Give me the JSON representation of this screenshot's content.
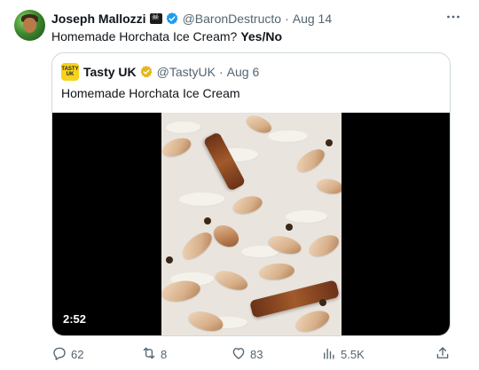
{
  "tweet": {
    "author": {
      "name": "Joseph Mallozzi",
      "handle": "@BaronDestructo",
      "date": "Aug 14"
    },
    "text": "Homemade Horchata Ice Cream?",
    "text_bold": "Yes/No",
    "more_icon": "more-horizontal-icon"
  },
  "quote": {
    "author": {
      "avatar_text": "TASTY UK",
      "name": "Tasty UK",
      "handle": "@TastyUK",
      "date": "Aug 6"
    },
    "text": "Homemade Horchata Ice Cream",
    "video": {
      "duration": "2:52"
    }
  },
  "actions": {
    "replies": "62",
    "reposts": "8",
    "likes": "83",
    "views": "5.5K"
  },
  "colors": {
    "text": "#0f1419",
    "secondary": "#536471",
    "verified_blue": "#1d9bf0",
    "verified_gold": "#e2b719",
    "border": "#cfd9de"
  }
}
